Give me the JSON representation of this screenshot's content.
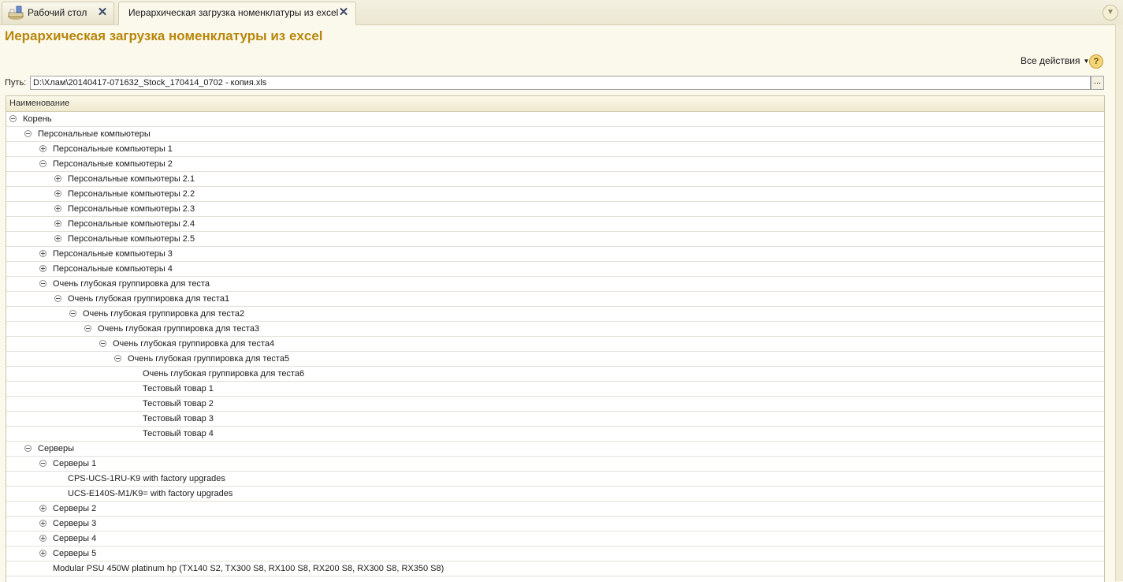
{
  "tabs": [
    {
      "label": "Рабочий стол",
      "active": false,
      "icon": "desktop-icon"
    },
    {
      "label": "Иерархическая загрузка номенклатуры из excel",
      "active": true
    }
  ],
  "header": {
    "title": "Иерархическая загрузка номенклатуры из excel",
    "all_actions": "Все действия",
    "help": "?"
  },
  "path": {
    "label": "Путь:",
    "value": "D:\\Хлам\\20140417-071632_Stock_170414_0702 - копия.xls",
    "browse": "..."
  },
  "grid": {
    "column": "Наименование",
    "rows": [
      {
        "level": 0,
        "state": "expanded",
        "label": "Корень"
      },
      {
        "level": 1,
        "state": "expanded",
        "label": "Персональные компьютеры"
      },
      {
        "level": 2,
        "state": "collapsed",
        "label": "Персональные компьютеры 1"
      },
      {
        "level": 2,
        "state": "expanded",
        "label": "Персональные компьютеры 2"
      },
      {
        "level": 3,
        "state": "collapsed",
        "label": "Персональные компьютеры 2.1"
      },
      {
        "level": 3,
        "state": "collapsed",
        "label": "Персональные компьютеры 2.2"
      },
      {
        "level": 3,
        "state": "collapsed",
        "label": "Персональные компьютеры 2.3"
      },
      {
        "level": 3,
        "state": "collapsed",
        "label": "Персональные компьютеры 2.4"
      },
      {
        "level": 3,
        "state": "collapsed",
        "label": "Персональные компьютеры 2.5"
      },
      {
        "level": 2,
        "state": "collapsed",
        "label": "Персональные компьютеры 3"
      },
      {
        "level": 2,
        "state": "collapsed",
        "label": "Персональные компьютеры 4"
      },
      {
        "level": 2,
        "state": "expanded",
        "label": "Очень глубокая группировка для теста"
      },
      {
        "level": 3,
        "state": "expanded",
        "label": "Очень глубокая группировка для теста1"
      },
      {
        "level": 4,
        "state": "expanded",
        "label": "Очень глубокая группировка для теста2"
      },
      {
        "level": 5,
        "state": "expanded",
        "label": "Очень глубокая группировка для теста3"
      },
      {
        "level": 6,
        "state": "expanded",
        "label": "Очень глубокая группировка для теста4"
      },
      {
        "level": 7,
        "state": "expanded",
        "label": "Очень глубокая группировка для теста5"
      },
      {
        "level": 8,
        "state": "leaf",
        "label": "Очень глубокая группировка для теста6"
      },
      {
        "level": 8,
        "state": "leaf",
        "label": "Тестовый товар 1"
      },
      {
        "level": 8,
        "state": "leaf",
        "label": "Тестовый товар 2"
      },
      {
        "level": 8,
        "state": "leaf",
        "label": "Тестовый товар 3"
      },
      {
        "level": 8,
        "state": "leaf",
        "label": "Тестовый товар 4"
      },
      {
        "level": 1,
        "state": "expanded",
        "label": "Серверы"
      },
      {
        "level": 2,
        "state": "expanded",
        "label": "Серверы 1"
      },
      {
        "level": 3,
        "state": "leaf",
        "label": "CPS-UCS-1RU-K9 with factory upgrades"
      },
      {
        "level": 3,
        "state": "leaf",
        "label": "UCS-E140S-M1/K9= with factory upgrades"
      },
      {
        "level": 2,
        "state": "collapsed",
        "label": "Серверы 2"
      },
      {
        "level": 2,
        "state": "collapsed",
        "label": "Серверы 3"
      },
      {
        "level": 2,
        "state": "collapsed",
        "label": "Серверы 4"
      },
      {
        "level": 2,
        "state": "collapsed",
        "label": "Серверы 5"
      },
      {
        "level": 2,
        "state": "leaf",
        "label": "Modular PSU 450W platinum hp (TX140 S2, TX300 S8, RX100 S8, RX200 S8, RX300 S8, RX350 S8)"
      }
    ]
  }
}
